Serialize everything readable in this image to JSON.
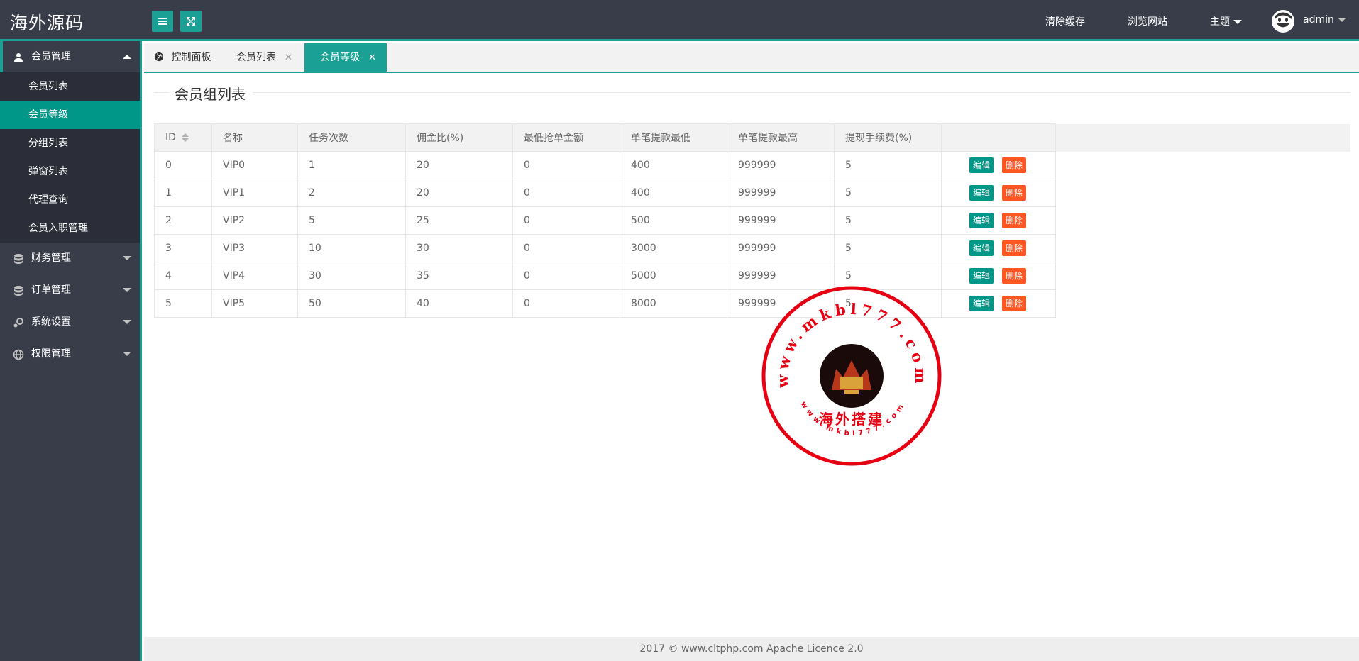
{
  "header": {
    "logo": "海外源码",
    "nav": [
      "清除缓存",
      "浏览网站",
      "主题"
    ],
    "user": "admin"
  },
  "sidebar": {
    "groups": [
      {
        "label": "会员管理",
        "icon": "user-icon",
        "expanded": true,
        "items": [
          "会员列表",
          "会员等级",
          "分组列表",
          "弹窗列表",
          "代理查询",
          "会员入职管理"
        ],
        "active": "会员等级"
      },
      {
        "label": "财务管理",
        "icon": "database-icon",
        "expanded": false
      },
      {
        "label": "订单管理",
        "icon": "database-icon",
        "expanded": false
      },
      {
        "label": "系统设置",
        "icon": "settings-icon",
        "expanded": false
      },
      {
        "label": "权限管理",
        "icon": "globe-icon",
        "expanded": false
      }
    ]
  },
  "tabs": [
    {
      "label": "控制面板",
      "icon": "globe-icon",
      "closable": false
    },
    {
      "label": "会员列表",
      "closable": true
    },
    {
      "label": "会员等级",
      "closable": true,
      "active": true
    }
  ],
  "page": {
    "title": "会员组列表"
  },
  "table": {
    "headers": [
      "ID",
      "名称",
      "任务次数",
      "佣金比(%)",
      "最低抢单金额",
      "单笔提款最低",
      "单笔提款最高",
      "提现手续费(%)",
      ""
    ],
    "rows": [
      [
        "0",
        "VIP0",
        "1",
        "20",
        "0",
        "400",
        "999999",
        "5"
      ],
      [
        "1",
        "VIP1",
        "2",
        "20",
        "0",
        "400",
        "999999",
        "5"
      ],
      [
        "2",
        "VIP2",
        "5",
        "25",
        "0",
        "500",
        "999999",
        "5"
      ],
      [
        "3",
        "VIP3",
        "10",
        "30",
        "0",
        "3000",
        "999999",
        "5"
      ],
      [
        "4",
        "VIP4",
        "30",
        "35",
        "0",
        "5000",
        "999999",
        "5"
      ],
      [
        "5",
        "VIP5",
        "50",
        "40",
        "0",
        "8000",
        "999999",
        "5"
      ]
    ],
    "edit_label": "编辑",
    "delete_label": "删除"
  },
  "footer": {
    "text": "2017 ©  www.cltphp.com  Apache Licence 2.0"
  },
  "stamp": {
    "url_text": "www.mkbl777.com",
    "label": "海外搭建",
    "small_text": "www.mkbl777.com"
  },
  "colors": {
    "header_bg": "#393d49",
    "accent": "#1aa094",
    "active": "#009688",
    "danger": "#ff5722"
  }
}
